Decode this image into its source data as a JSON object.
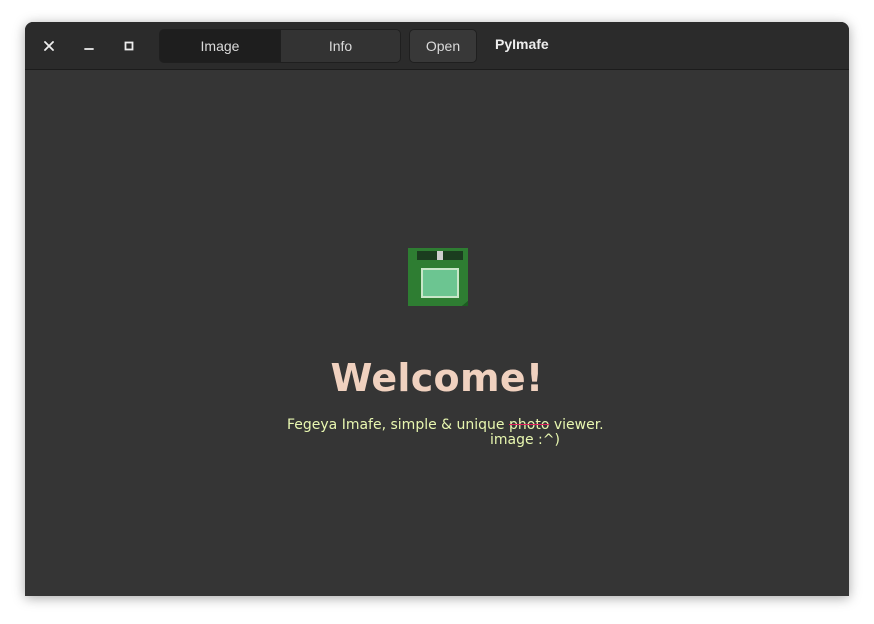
{
  "window": {
    "title": "PyImafe",
    "controls": {
      "close_icon": "close-icon",
      "minimize_icon": "minimize-icon",
      "maximize_icon": "maximize-icon"
    }
  },
  "header": {
    "tabs": [
      {
        "label": "Image",
        "active": true
      },
      {
        "label": "Info",
        "active": false
      }
    ],
    "open_label": "Open"
  },
  "welcome": {
    "icon": "floppy-disk-icon",
    "heading": "Welcome!",
    "tagline_before": "Fegeya Imafe, simple & unique ",
    "tagline_struck": "photo",
    "tagline_after": " viewer.",
    "tagline_correction": "image :^)"
  },
  "colors": {
    "window_bg": "#353535",
    "header_bg": "#2b2b2b",
    "heading": "#f0d1bf",
    "tagline": "#e8f7b0",
    "strike": "#e0245e",
    "floppy_body": "#2e7d32",
    "floppy_label": "#6cc591"
  }
}
